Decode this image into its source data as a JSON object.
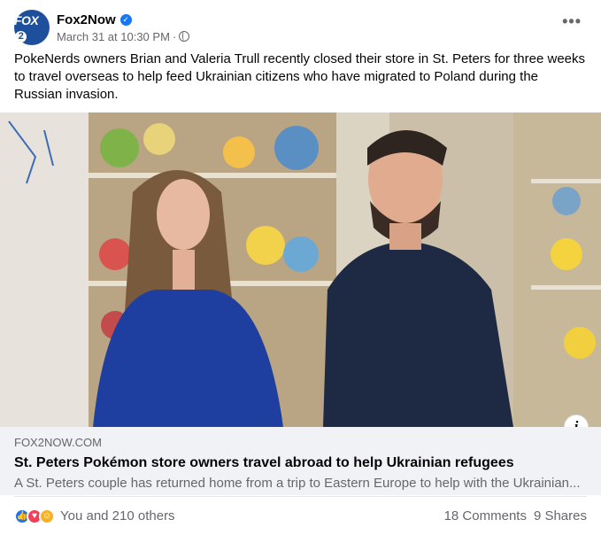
{
  "header": {
    "page_name": "Fox2Now",
    "avatar_text": "FOX",
    "avatar_num": "2",
    "timestamp": "March 31 at 10:30 PM",
    "separator": "·",
    "more": "•••"
  },
  "post": {
    "caption": "PokeNerds owners Brian and Valeria Trull recently closed their store in St. Peters for three weeks to travel overseas to help feed Ukrainian citizens who have migrated to Poland during the Russian invasion."
  },
  "media": {
    "info_icon": "i"
  },
  "link": {
    "domain": "FOX2NOW.COM",
    "headline": "St. Peters Pokémon store owners travel abroad to help Ukrainian refugees",
    "description": "A St. Peters couple has returned home from a trip to Eastern Europe to help with the Ukrainian..."
  },
  "footer": {
    "reactions_text": "You and 210 others",
    "comments": "18 Comments",
    "shares": "9 Shares"
  },
  "colors": {
    "brand_blue": "#1877f2",
    "fox_blue": "#1d4f9c",
    "muted": "#65676b",
    "preview_bg": "#f0f2f5"
  }
}
